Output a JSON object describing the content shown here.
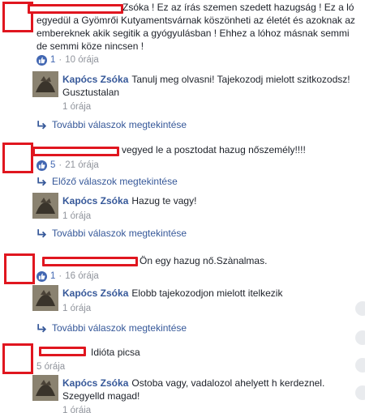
{
  "comments": [
    {
      "text": "Zsóka ! Ez az írás szemen szedett hazugság ! Ez a ló egyedül a Gyömrői Kutyamentsvárnak köszönheti az életét és azoknak az embereknek akik segitik a gyógyulásban ! Ehhez a lóhoz másnak semmi de semmi köze nincsen !",
      "reactions": "1",
      "time": "10 órája",
      "reply": {
        "author": "Kapócs Zsóka",
        "text": "Tanulj meg olvasni! Tajekozodj mielott szitkozodsz! Gusztustalan",
        "time": "1 órája"
      },
      "more_replies": "További válaszok megtekintése"
    },
    {
      "text": "vegyed le a posztodat hazug nőszemély!!!!",
      "reactions": "5",
      "time": "21 órája",
      "prev_replies": "Előző válaszok megtekintése",
      "reply": {
        "author": "Kapócs Zsóka",
        "text": "Hazug te vagy!",
        "time": "1 órája"
      },
      "more_replies": "További válaszok megtekintése"
    },
    {
      "text": "Ön egy hazug nő.Szànalmas.",
      "reactions": "1",
      "time": "16 órája",
      "reply": {
        "author": "Kapócs Zsóka",
        "text": "Elobb tajekozodjon mielott itelkezik",
        "time": "1 órája"
      },
      "more_replies": "További válaszok megtekintése"
    },
    {
      "text": "Idióta picsa",
      "time": "5 órája",
      "reply": {
        "author": "Kapócs Zsóka",
        "text": "Ostoba vagy, vadalozol ahelyett h kerdeznel. Szegyelld magad!",
        "time": "1 órája"
      }
    }
  ],
  "colors": {
    "link": "#365899",
    "redact": "#e0161f",
    "meta": "#90949c",
    "like": "#4267b2"
  }
}
